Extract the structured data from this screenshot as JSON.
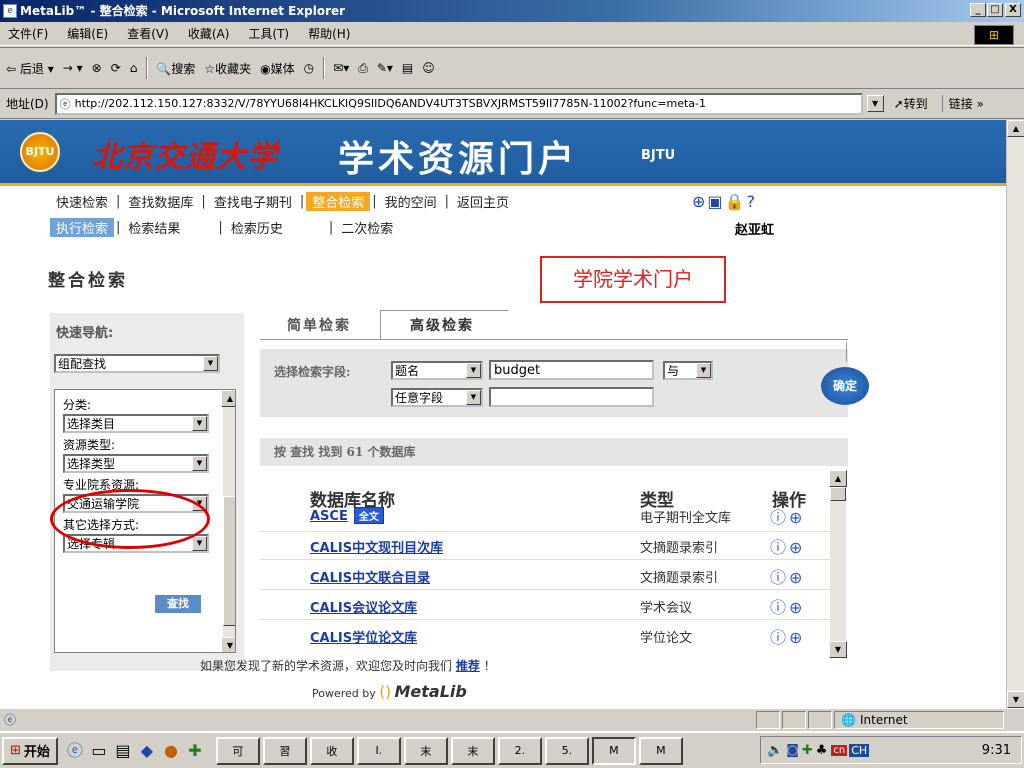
{
  "window": {
    "title": "MetaLib™ - 整合检索 - Microsoft Internet Explorer",
    "minimize": "_",
    "maximize": "□",
    "close": "X"
  },
  "menu": [
    "文件(F)",
    "编辑(E)",
    "查看(V)",
    "收藏(A)",
    "工具(T)",
    "帮助(H)"
  ],
  "toolbar": {
    "back": "后退",
    "forward": "→",
    "search": "搜索",
    "favorites": "收藏夹",
    "media": "媒体"
  },
  "address": {
    "label": "地址(D)",
    "url": "http://202.112.150.127:8332/V/78YYU68I4HKCLKIQ9SIIDQ6ANDV4UT3TSBVXJRMST59II7785N-11002?func=meta-1",
    "go": "转到",
    "links": "链接"
  },
  "banner": {
    "university": "北京交通大学",
    "portal": "学术资源门户",
    "code": "BJTU"
  },
  "nav": {
    "row1": [
      "快速检索",
      "查找数据库",
      "查找电子期刊",
      "整合检索",
      "我的空间",
      "返回主页"
    ],
    "row2": [
      "执行检索",
      "检索结果",
      "检索历史",
      "二次检索"
    ],
    "user": "赵亚虹"
  },
  "page": {
    "title": "整合检索",
    "annotation": "学院学术门户"
  },
  "left_panel": {
    "quick_nav_label": "快速导航:",
    "quick_nav_value": "组配查找",
    "category_label": "分类:",
    "category_value": "选择类目",
    "resource_type_label": "资源类型:",
    "resource_type_value": "选择类型",
    "department_label": "专业院系资源:",
    "department_value": "交通运输学院",
    "other_label": "其它选择方式:",
    "other_value": "选择专辑",
    "find_button": "查找"
  },
  "search": {
    "tab_simple": "简单检索",
    "tab_advanced": "高级检索",
    "field_label": "选择检索字段:",
    "field1": "题名",
    "term1": "budget",
    "operator": "与",
    "field2": "任意字段",
    "term2": "",
    "go_button": "确定"
  },
  "results": {
    "summary": "按 查找 找到 61 个数据库",
    "col_name": "数据库名称",
    "col_type": "类型",
    "col_ops": "操作",
    "fulltext_badge": "全文",
    "rows": [
      {
        "name": "ASCE",
        "type": "电子期刊全文库",
        "fulltext": true
      },
      {
        "name": "CALIS中文现刊目次库",
        "type": "文摘题录索引",
        "fulltext": false
      },
      {
        "name": "CALIS中文联合目录",
        "type": "文摘题录索引",
        "fulltext": false
      },
      {
        "name": "CALIS会议论文库",
        "type": "学术会议",
        "fulltext": false
      },
      {
        "name": "CALIS学位论文库",
        "type": "学位论文",
        "fulltext": false
      }
    ]
  },
  "footer": {
    "message": "如果您发现了新的学术资源，欢迎您及时向我们",
    "recommend": "推荐",
    "exclaim": "！",
    "powered_by": "Powered by",
    "brand": "MetaLib"
  },
  "status": {
    "zone": "Internet"
  },
  "taskbar": {
    "start": "开始",
    "tasks": [
      "可",
      "習",
      "收",
      "I.",
      "末",
      "末",
      "2.",
      "5.",
      "M",
      "M"
    ],
    "ime": "CH",
    "clock": "9:31"
  }
}
